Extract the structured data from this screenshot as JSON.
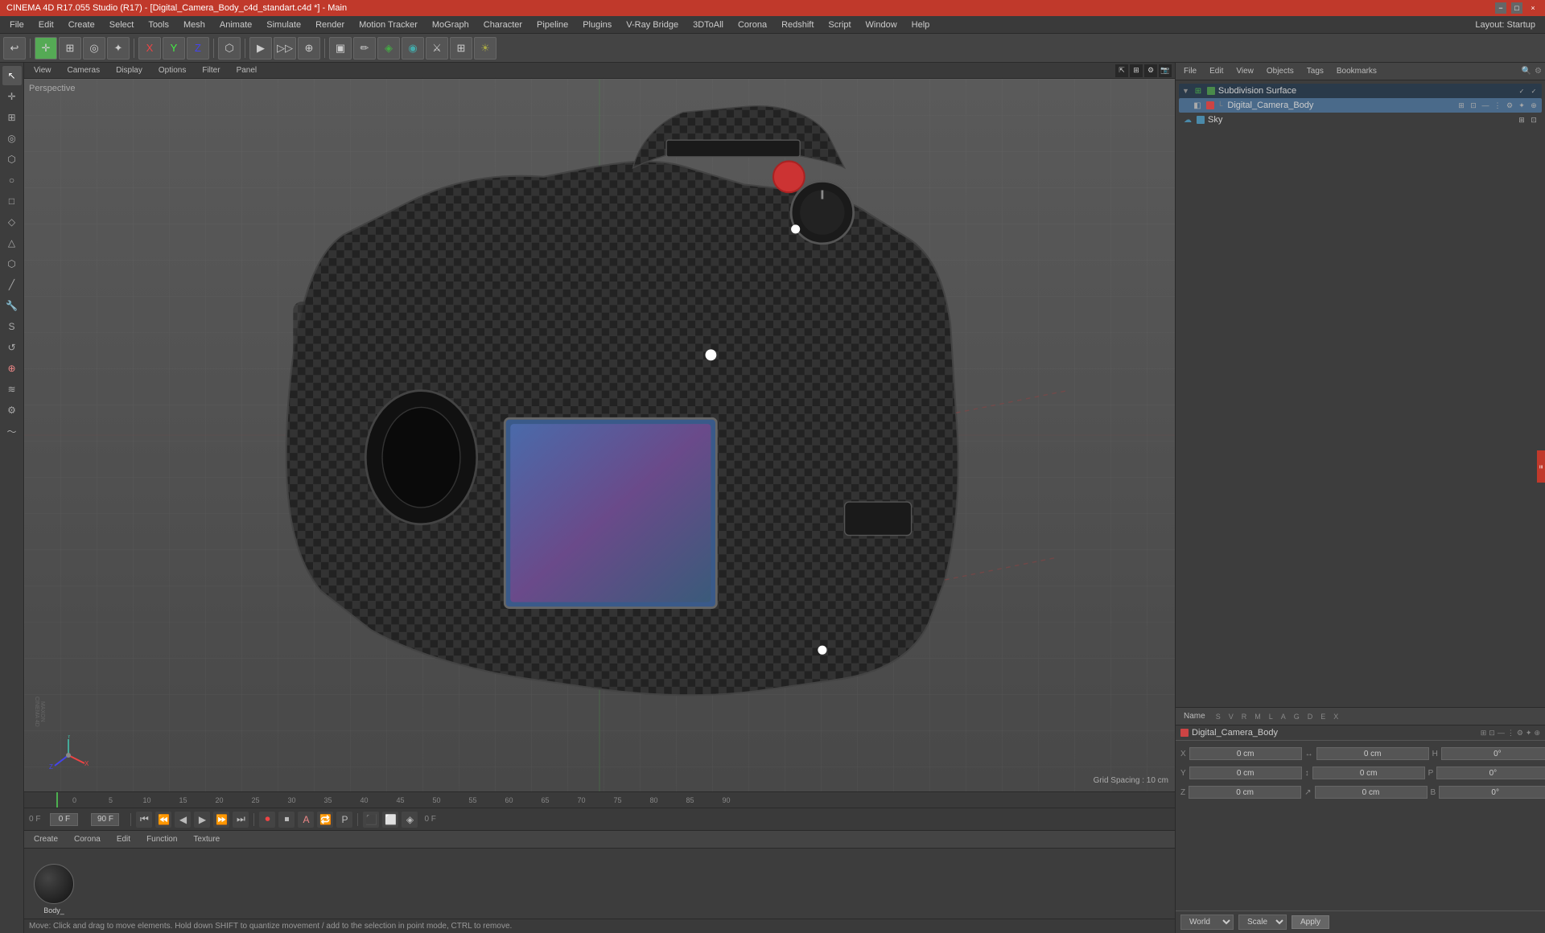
{
  "titleBar": {
    "title": "CINEMA 4D R17.055 Studio (R17) - [Digital_Camera_Body_c4d_standart.c4d *] - Main",
    "minLabel": "−",
    "maxLabel": "□",
    "closeLabel": "×"
  },
  "menuBar": {
    "items": [
      "File",
      "Edit",
      "Create",
      "Select",
      "Tools",
      "Mesh",
      "Animate",
      "Simulate",
      "Render",
      "Motion Tracker",
      "MoGraph",
      "Character",
      "Pipeline",
      "Plugins",
      "V-Ray Bridge",
      "3DToAll",
      "Corona",
      "Redshift",
      "Script",
      "Window",
      "Help"
    ],
    "layout_label": "Layout:",
    "layout_value": "Startup"
  },
  "viewport": {
    "tabs": [
      "View",
      "Cameras",
      "Display",
      "Options",
      "Filter",
      "Panel"
    ],
    "perspective_label": "Perspective",
    "grid_spacing": "Grid Spacing : 10 cm",
    "axis_x": "X",
    "axis_y": "Y",
    "axis_z": "Z"
  },
  "timeline": {
    "marks": [
      "0",
      "5",
      "10",
      "15",
      "20",
      "25",
      "30",
      "35",
      "40",
      "45",
      "50",
      "55",
      "60",
      "65",
      "70",
      "75",
      "80",
      "85",
      "90"
    ],
    "current_frame": "0 F",
    "end_frame": "90 F",
    "fps_display": "0 F"
  },
  "materialEditor": {
    "tabs": [
      "Create",
      "Corona",
      "Edit",
      "Function",
      "Texture"
    ],
    "material_name": "Body_"
  },
  "objectManager": {
    "toolbar": [
      "File",
      "Edit",
      "View",
      "Objects",
      "Tags",
      "Bookmarks"
    ],
    "objects": [
      {
        "name": "Subdivision Surface",
        "type": "subdivsurface",
        "color": "#4a8a4a",
        "indent": 0
      },
      {
        "name": "Digital_Camera_Body",
        "type": "polygon",
        "color": "#cc4444",
        "indent": 1
      },
      {
        "name": "Sky",
        "type": "sky",
        "color": "#4a8aaa",
        "indent": 0
      }
    ]
  },
  "attributeManager": {
    "toolbar": [
      "Name",
      "S",
      "V",
      "R",
      "M",
      "L",
      "A",
      "G",
      "D",
      "E",
      "X"
    ],
    "selected_object": "Digital_Camera_Body",
    "coords": {
      "x_pos": "0 cm",
      "y_pos": "0 cm",
      "z_pos": "0 cm",
      "x_rot": "0°",
      "y_rot": "0°",
      "z_rot": "0°",
      "x_scl": "0 cm",
      "y_scl": "0 cm",
      "z_scl": "0 cm",
      "h": "0°",
      "p": "0°",
      "b": "0°"
    },
    "coord_labels": {
      "x": "X",
      "y": "Y",
      "z": "Z"
    },
    "world_label": "World",
    "scale_label": "Scale",
    "apply_label": "Apply"
  },
  "statusBar": {
    "message": "Move: Click and drag to move elements. Hold down SHIFT to quantize movement / add to the selection in point mode, CTRL to remove."
  },
  "tools": {
    "sidebar": [
      "▶",
      "↔",
      "↺",
      "⊡",
      "✦",
      "○",
      "□",
      "◇",
      "△",
      "⬡",
      "╱",
      "🔧",
      "S",
      "🔄",
      "⊕",
      "≋",
      "⚙"
    ]
  }
}
